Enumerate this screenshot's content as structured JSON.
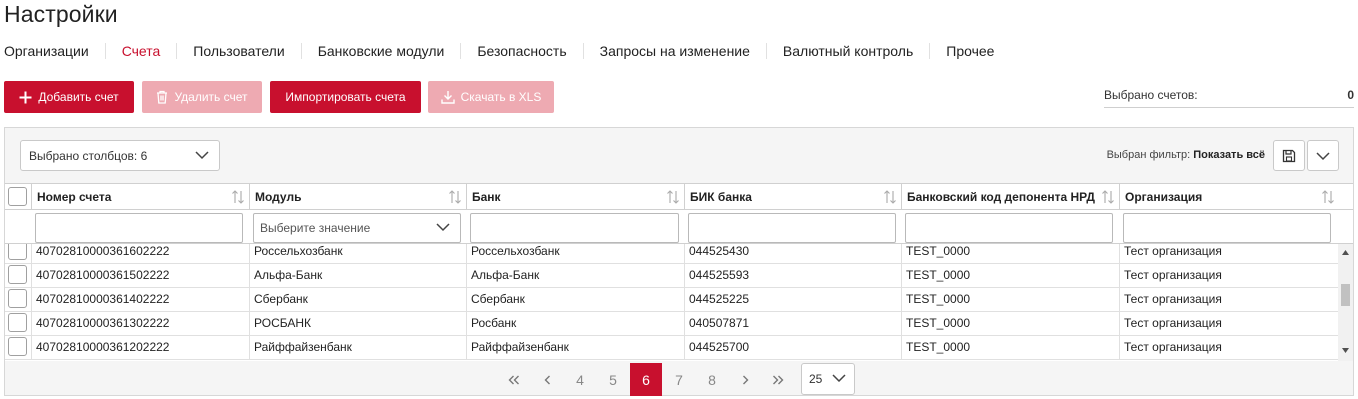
{
  "page": {
    "title": "Настройки"
  },
  "nav": {
    "items": [
      {
        "label": "Организации",
        "active": false
      },
      {
        "label": "Счета",
        "active": true
      },
      {
        "label": "Пользователи",
        "active": false
      },
      {
        "label": "Банковские модули",
        "active": false
      },
      {
        "label": "Безопасность",
        "active": false
      },
      {
        "label": "Запросы на изменение",
        "active": false
      },
      {
        "label": "Валютный контроль",
        "active": false
      },
      {
        "label": "Прочее",
        "active": false
      }
    ]
  },
  "toolbar": {
    "add_label": "Добавить счет",
    "delete_label": "Удалить счет",
    "import_label": "Импортировать счета",
    "download_label": "Скачать в XLS"
  },
  "counter": {
    "label": "Выбрано счетов:",
    "value": "0"
  },
  "grid": {
    "columns_select": "Выбрано столбцов: 6",
    "filter_label": "Выбран фильтр:",
    "filter_value": "Показать всё",
    "columns": [
      "Номер счета",
      "Модуль",
      "Банк",
      "БИК банка",
      "Банковский код депонента НРД",
      "Организация"
    ],
    "module_placeholder": "Выберите значение",
    "rows": [
      [
        "40702810000361602222",
        "Россельхозбанк",
        "Россельхозбанк",
        "044525430",
        "TEST_0000",
        "Тест организация"
      ],
      [
        "40702810000361502222",
        "Альфа-Банк",
        "Альфа-Банк",
        "044525593",
        "TEST_0000",
        "Тест организация"
      ],
      [
        "40702810000361402222",
        "Сбербанк",
        "Сбербанк",
        "044525225",
        "TEST_0000",
        "Тест организация"
      ],
      [
        "40702810000361302222",
        "РОСБАНК",
        "Росбанк",
        "040507871",
        "TEST_0000",
        "Тест организация"
      ],
      [
        "40702810000361202222",
        "Райффайзенбанк",
        "Райффайзенбанк",
        "044525700",
        "TEST_0000",
        "Тест организация"
      ]
    ]
  },
  "pagination": {
    "pages": [
      "4",
      "5",
      "6",
      "7",
      "8"
    ],
    "current": "6",
    "page_size": "25"
  },
  "colors": {
    "accent": "#c8102e",
    "accent_disabled": "#eeaab2"
  },
  "icons": [
    "plus-icon",
    "trash-icon",
    "download-icon",
    "save-icon",
    "chevron-down-icon",
    "sort-icon",
    "first-page-icon",
    "prev-page-icon",
    "next-page-icon",
    "last-page-icon"
  ]
}
